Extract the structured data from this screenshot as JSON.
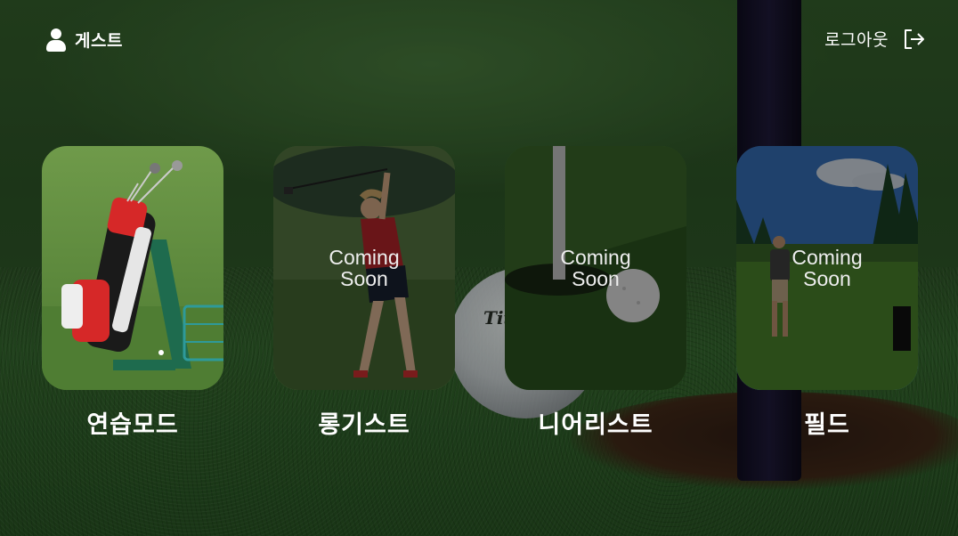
{
  "user": {
    "name": "게스트",
    "icon": "user-icon"
  },
  "logout": {
    "label": "로그아웃",
    "icon": "logout-icon"
  },
  "modes": [
    {
      "title": "연습모드",
      "coming_soon": false,
      "badge": ""
    },
    {
      "title": "롱기스트",
      "coming_soon": true,
      "badge_line1": "Coming",
      "badge_line2": "Soon"
    },
    {
      "title": "니어리스트",
      "coming_soon": true,
      "badge_line1": "Coming",
      "badge_line2": "Soon"
    },
    {
      "title": "필드",
      "coming_soon": true,
      "badge_line1": "Coming",
      "badge_line2": "Soon"
    }
  ],
  "background": {
    "ball_brand": "Tit"
  },
  "colors": {
    "grass": "#2d5a27",
    "text": "#ffffff",
    "pole": "#1b1732"
  }
}
